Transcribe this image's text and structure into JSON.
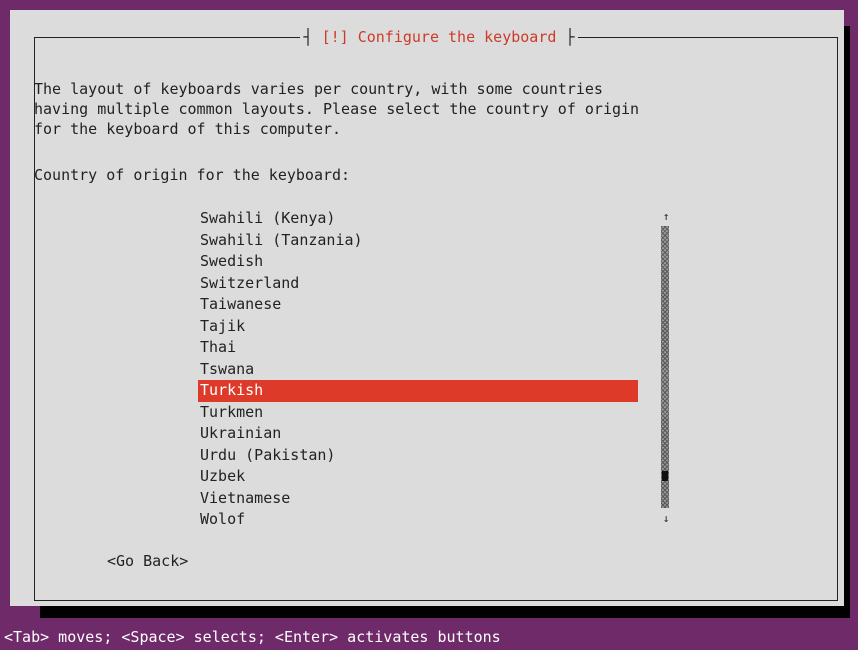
{
  "dialog": {
    "title_marker": "[!]",
    "title_text": "Configure the keyboard",
    "description_line1": "The layout of keyboards varies per country, with some countries",
    "description_line2": "having multiple common layouts. Please select the country of origin",
    "description_line3": "for the keyboard of this computer.",
    "prompt": "Country of origin for the keyboard:",
    "go_back_label": "<Go Back>"
  },
  "list": {
    "selected_index": 8,
    "items": [
      "Swahili (Kenya)",
      "Swahili (Tanzania)",
      "Swedish",
      "Switzerland",
      "Taiwanese",
      "Tajik",
      "Thai",
      "Tswana",
      "Turkish",
      "Turkmen",
      "Ukrainian",
      "Urdu (Pakistan)",
      "Uzbek",
      "Vietnamese",
      "Wolof"
    ]
  },
  "scrollbar": {
    "up_arrow": "↑",
    "down_arrow": "↓",
    "position_fraction": 0.9
  },
  "status_bar": {
    "text": "<Tab> moves; <Space> selects; <Enter> activates buttons"
  },
  "colors": {
    "background": "#6f2a6a",
    "dialog": "#dcdcdc",
    "accent": "#dd3a2a",
    "title": "#cc3b2a"
  }
}
